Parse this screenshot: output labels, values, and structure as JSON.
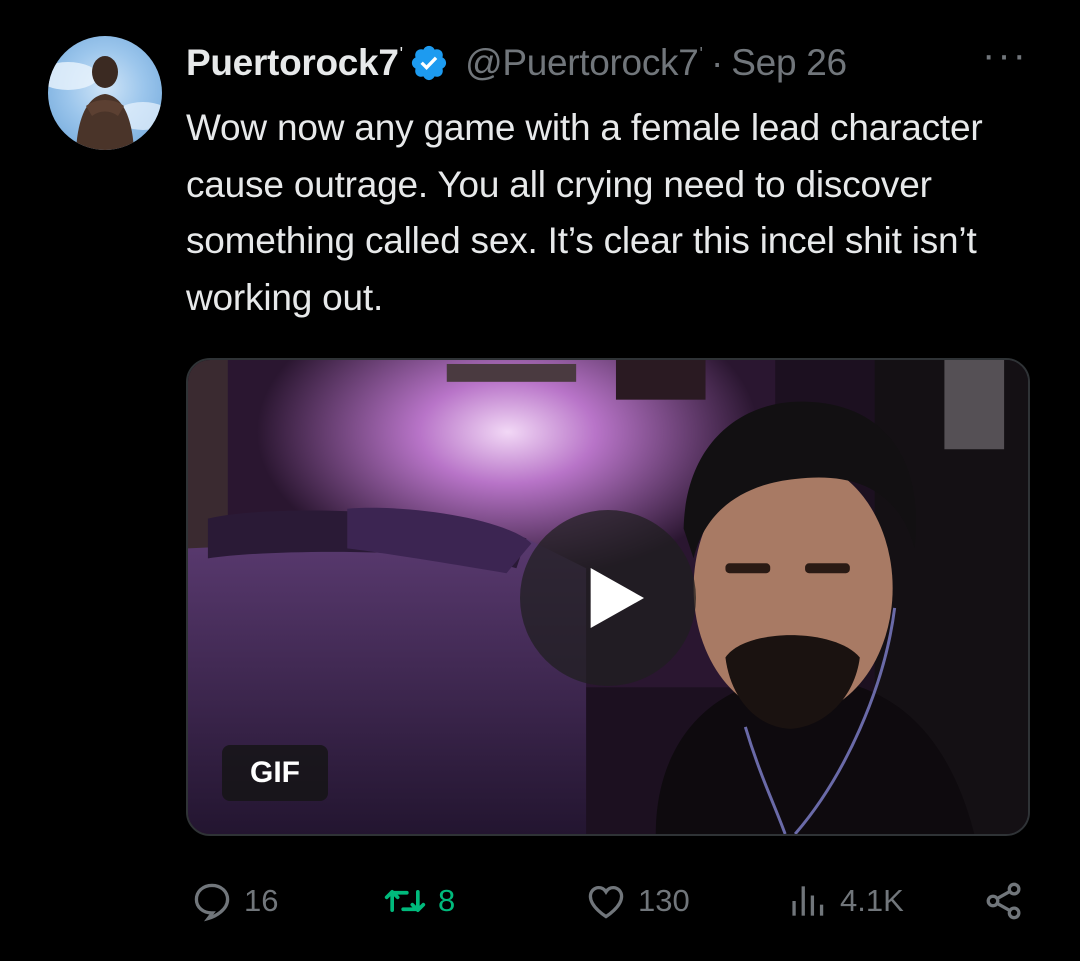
{
  "tweet": {
    "display_name": "Puertorock7",
    "name_suffix": "'",
    "handle": "@Puertorock7",
    "handle_suffix": "'",
    "separator": "·",
    "date": "Sep 26",
    "more_label": "···",
    "text": "Wow now any game with a female lead character cause outrage. You all crying need to discover something called sex. It’s clear this incel shit isn’t working out.",
    "media": {
      "badge": "GIF",
      "play_icon": "play-icon"
    },
    "actions": {
      "replies": "16",
      "retweets": "8",
      "likes": "130",
      "views": "4.1K"
    }
  },
  "colors": {
    "background": "#000000",
    "text": "#e7e9ea",
    "secondary": "#71767b",
    "verified": "#1d9bf0",
    "retweet_active": "#00ba7c"
  },
  "icons": {
    "verified": "verified-badge-icon",
    "more": "more-options-icon",
    "reply": "reply-icon",
    "retweet": "retweet-icon",
    "like": "heart-icon",
    "views": "views-icon",
    "share": "share-icon"
  }
}
